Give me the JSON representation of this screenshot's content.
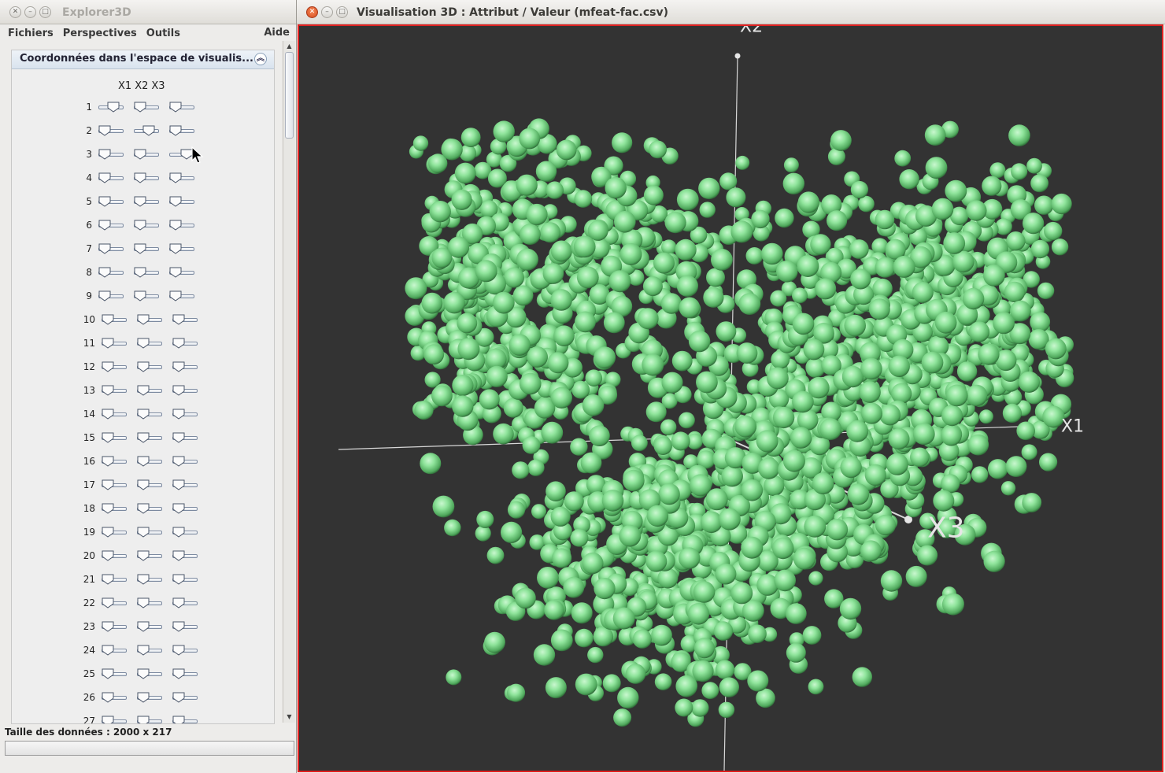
{
  "left_window": {
    "title": "Explorer3D",
    "menu": [
      "Fichiers",
      "Perspectives",
      "Outils"
    ],
    "menu_help": "Aide",
    "panel_title": "Coordonnées dans l'espace de visualis...",
    "axis_headers": [
      "X1",
      "X2",
      "X3"
    ],
    "rows": [
      {
        "label": "1",
        "x1": 0.7,
        "x2": 0.0,
        "x3": 0.0
      },
      {
        "label": "2",
        "x1": 0.0,
        "x2": 0.7,
        "x3": 0.0
      },
      {
        "label": "3",
        "x1": 0.0,
        "x2": 0.0,
        "x3": 0.85
      },
      {
        "label": "4",
        "x1": 0.0,
        "x2": 0.0,
        "x3": 0.0
      },
      {
        "label": "5",
        "x1": 0.0,
        "x2": 0.0,
        "x3": 0.0
      },
      {
        "label": "6",
        "x1": 0.0,
        "x2": 0.0,
        "x3": 0.0
      },
      {
        "label": "7",
        "x1": 0.0,
        "x2": 0.0,
        "x3": 0.0
      },
      {
        "label": "8",
        "x1": 0.0,
        "x2": 0.0,
        "x3": 0.0
      },
      {
        "label": "9",
        "x1": 0.0,
        "x2": 0.0,
        "x3": 0.0
      },
      {
        "label": "10",
        "x1": 0.0,
        "x2": 0.0,
        "x3": 0.0
      },
      {
        "label": "11",
        "x1": 0.0,
        "x2": 0.0,
        "x3": 0.0
      },
      {
        "label": "12",
        "x1": 0.0,
        "x2": 0.0,
        "x3": 0.0
      },
      {
        "label": "13",
        "x1": 0.0,
        "x2": 0.0,
        "x3": 0.0
      },
      {
        "label": "14",
        "x1": 0.0,
        "x2": 0.0,
        "x3": 0.0
      },
      {
        "label": "15",
        "x1": 0.0,
        "x2": 0.0,
        "x3": 0.0
      },
      {
        "label": "16",
        "x1": 0.0,
        "x2": 0.0,
        "x3": 0.0
      },
      {
        "label": "17",
        "x1": 0.0,
        "x2": 0.0,
        "x3": 0.0
      },
      {
        "label": "18",
        "x1": 0.0,
        "x2": 0.0,
        "x3": 0.0
      },
      {
        "label": "19",
        "x1": 0.0,
        "x2": 0.0,
        "x3": 0.0
      },
      {
        "label": "20",
        "x1": 0.0,
        "x2": 0.0,
        "x3": 0.0
      },
      {
        "label": "21",
        "x1": 0.0,
        "x2": 0.0,
        "x3": 0.0
      },
      {
        "label": "22",
        "x1": 0.0,
        "x2": 0.0,
        "x3": 0.0
      },
      {
        "label": "23",
        "x1": 0.0,
        "x2": 0.0,
        "x3": 0.0
      },
      {
        "label": "24",
        "x1": 0.0,
        "x2": 0.0,
        "x3": 0.0
      },
      {
        "label": "25",
        "x1": 0.0,
        "x2": 0.0,
        "x3": 0.0
      },
      {
        "label": "26",
        "x1": 0.0,
        "x2": 0.0,
        "x3": 0.0
      },
      {
        "label": "27",
        "x1": 0.0,
        "x2": 0.0,
        "x3": 0.0
      }
    ],
    "status": "Taille des données : 2000 x 217"
  },
  "right_window": {
    "title": "Visualisation 3D : Attribut / Valeur (mfeat-fac.csv)",
    "axes": [
      {
        "name": "X1"
      },
      {
        "name": "X2"
      },
      {
        "name": "X3"
      }
    ],
    "point_color": "#7ddc8c",
    "background_color": "#333333",
    "frame_color": "#e02222"
  },
  "chart_data": {
    "type": "scatter",
    "title": "",
    "xlabel": "X1",
    "ylabel": "X2",
    "zlabel": "X3",
    "grid": false
  },
  "icons": {
    "close": "close-icon",
    "minimize": "minimize-icon",
    "maximize": "maximize-icon",
    "collapse": "chevron-up-icon",
    "cursor": "mouse-pointer-icon"
  }
}
